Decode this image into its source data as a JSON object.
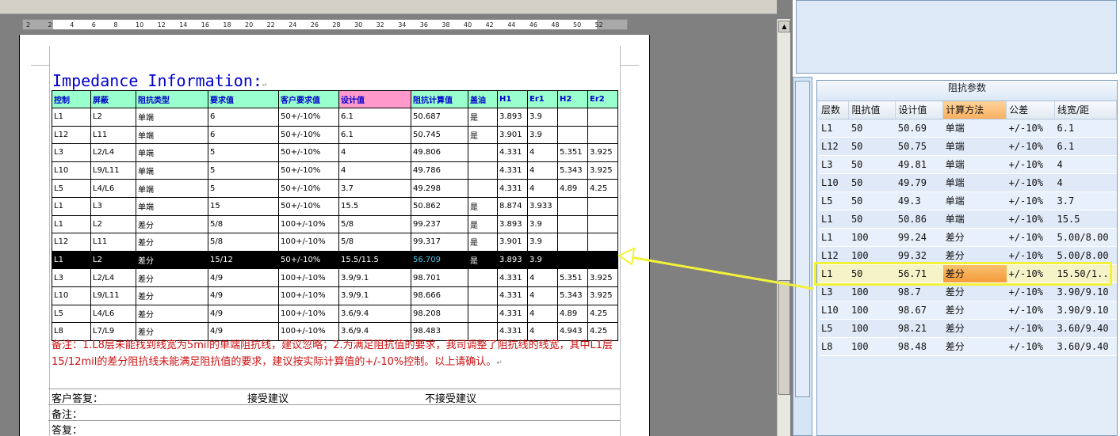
{
  "ruler": {
    "ticks": [
      "2",
      "2",
      "4",
      "6",
      "8",
      "10",
      "12",
      "14",
      "16",
      "18",
      "20",
      "22",
      "24",
      "26",
      "28",
      "30",
      "32",
      "34",
      "36",
      "38",
      "40",
      "42",
      "44",
      "46",
      "48",
      "50",
      "52"
    ]
  },
  "doc": {
    "heading": "Impedance Information:",
    "columns": [
      "控制",
      "屏蔽",
      "阻抗类型",
      "要求值",
      "客户要求值",
      "设计值",
      "阻抗计算值",
      "盖油",
      "H1",
      "Er1",
      "H2",
      "Er2"
    ],
    "rows": [
      [
        "L1",
        "L2",
        "单端",
        "6",
        "50+/-10%",
        "6.1",
        "50.687",
        "是",
        "3.893",
        "3.9",
        "",
        ""
      ],
      [
        "L12",
        "L11",
        "单端",
        "6",
        "50+/-10%",
        "6.1",
        "50.745",
        "是",
        "3.901",
        "3.9",
        "",
        ""
      ],
      [
        "L3",
        "L2/L4",
        "单端",
        "5",
        "50+/-10%",
        "4",
        "49.806",
        "",
        "4.331",
        "4",
        "5.351",
        "3.925"
      ],
      [
        "L10",
        "L9/L11",
        "单端",
        "5",
        "50+/-10%",
        "4",
        "49.786",
        "",
        "4.331",
        "4",
        "5.343",
        "3.925"
      ],
      [
        "L5",
        "L4/L6",
        "单端",
        "5",
        "50+/-10%",
        "3.7",
        "49.298",
        "",
        "4.331",
        "4",
        "4.89",
        "4.25"
      ],
      [
        "L1",
        "L3",
        "单端",
        "15",
        "50+/-10%",
        "15.5",
        "50.862",
        "是",
        "8.874",
        "3.933",
        "",
        ""
      ],
      [
        "L1",
        "L2",
        "差分",
        "5/8",
        "100+/-10%",
        "5/8",
        "99.237",
        "是",
        "3.893",
        "3.9",
        "",
        ""
      ],
      [
        "L12",
        "L11",
        "差分",
        "5/8",
        "100+/-10%",
        "5/8",
        "99.317",
        "是",
        "3.901",
        "3.9",
        "",
        ""
      ],
      [
        "L1",
        "L2",
        "差分",
        "15/12",
        "50+/-10%",
        "15.5/11.5",
        "56.709",
        "是",
        "3.893",
        "3.9",
        "",
        ""
      ],
      [
        "L3",
        "L2/L4",
        "差分",
        "4/9",
        "100+/-10%",
        "3.9/9.1",
        "98.701",
        "",
        "4.331",
        "4",
        "5.351",
        "3.925"
      ],
      [
        "L10",
        "L9/L11",
        "差分",
        "4/9",
        "100+/-10%",
        "3.9/9.1",
        "98.666",
        "",
        "4.331",
        "4",
        "5.343",
        "3.925"
      ],
      [
        "L5",
        "L4/L6",
        "差分",
        "4/9",
        "100+/-10%",
        "3.6/9.4",
        "98.208",
        "",
        "4.331",
        "4",
        "4.89",
        "4.25"
      ],
      [
        "L8",
        "L7/L9",
        "差分",
        "4/9",
        "100+/-10%",
        "3.6/9.4",
        "98.483",
        "",
        "4.331",
        "4",
        "4.943",
        "4.25"
      ]
    ],
    "selected_row": 8,
    "remark": "备注：1.L8层未能找到线宽为5mil的单端阻抗线，建议忽略；2.为满足阻抗值的要求，我司调整了阻抗线的线宽，其中L1层15/12mil的差分阻抗线未能满足阻抗值的要求，建议按实际计算值的+/-10%控制。以上请确认。",
    "customer_reply": "客户答复：",
    "accept": "接受建议",
    "reject": "不接受建议",
    "note": "备注：",
    "answer": "答复："
  },
  "grid": {
    "title": "阻抗参数",
    "columns": [
      "层数",
      "阻抗值",
      "设计值",
      "计算方法",
      "公差",
      "线宽/距"
    ],
    "rows": [
      [
        "L1",
        "50",
        "50.69",
        "单端",
        "+/-10%",
        "6.1"
      ],
      [
        "L12",
        "50",
        "50.75",
        "单端",
        "+/-10%",
        "6.1"
      ],
      [
        "L3",
        "50",
        "49.81",
        "单端",
        "+/-10%",
        "4"
      ],
      [
        "L10",
        "50",
        "49.79",
        "单端",
        "+/-10%",
        "4"
      ],
      [
        "L5",
        "50",
        "49.3",
        "单端",
        "+/-10%",
        "3.7"
      ],
      [
        "L1",
        "50",
        "50.86",
        "单端",
        "+/-10%",
        "15.5"
      ],
      [
        "L1",
        "100",
        "99.24",
        "差分",
        "+/-10%",
        "5.00/8.00"
      ],
      [
        "L12",
        "100",
        "99.32",
        "差分",
        "+/-10%",
        "5.00/8.00"
      ],
      [
        "L1",
        "50",
        "56.71",
        "差分",
        "+/-10%",
        "15.50/1.."
      ],
      [
        "L3",
        "100",
        "98.7",
        "差分",
        "+/-10%",
        "3.90/9.10"
      ],
      [
        "L10",
        "100",
        "98.67",
        "差分",
        "+/-10%",
        "3.90/9.10"
      ],
      [
        "L5",
        "100",
        "98.21",
        "差分",
        "+/-10%",
        "3.60/9.40"
      ],
      [
        "L8",
        "100",
        "98.48",
        "差分",
        "+/-10%",
        "3.60/9.40"
      ]
    ],
    "selected_row": 8
  },
  "colors": {
    "heading_blue": "#0000cc",
    "header_aqua": "#99ffcc",
    "header_pink": "#ff99cc",
    "remark_red": "#cc1111",
    "callout_yellow": "#f2f23a",
    "grid_header_orange": "#f7b061"
  }
}
